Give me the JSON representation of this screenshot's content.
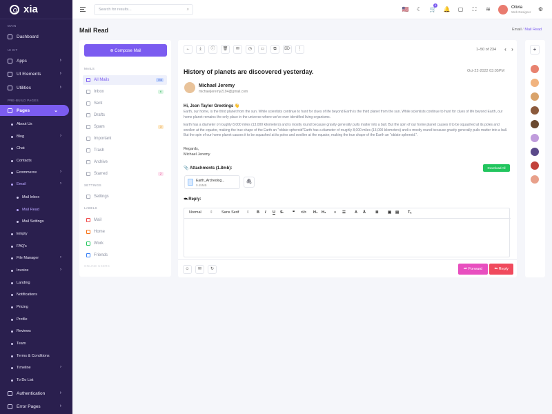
{
  "app": {
    "logo": "xia"
  },
  "sidebar": {
    "sections": {
      "main": "MAIN",
      "ui_kit": "UI KIT",
      "pre_build": "PRE-BUILD PAGES"
    },
    "items": {
      "dashboard": "Dashboard",
      "apps": "Apps",
      "ui_elements": "UI Elements",
      "utilities": "Utilities",
      "pages": "Pages",
      "authentication": "Authentication",
      "error_pages": "Error Pages"
    },
    "subitems": [
      "About Us",
      "Blog",
      "Chat",
      "Contacts",
      "Ecommerce",
      "Email",
      "Empty",
      "FAQ's",
      "File Manager",
      "Invoice",
      "Landing",
      "Notifications",
      "Pricing",
      "Profile",
      "Reviews",
      "Team",
      "Terms & Conditions",
      "Timeline",
      "To Do List"
    ],
    "email_sub": [
      "Mail Inbox",
      "Mail Read",
      "Mail Settings"
    ]
  },
  "topbar": {
    "search_placeholder": "Search for results...",
    "cart_badge": "4",
    "user_name": "Olivia",
    "user_role": "Web Designer"
  },
  "page": {
    "title": "Mail Read",
    "crumb_parent": "Email",
    "crumb_sep": "/",
    "crumb_current": "Mail Read"
  },
  "mailnav": {
    "compose": "⊕ Compose Mail",
    "mails_label": "MAILS",
    "items": [
      {
        "label": "All Mails",
        "count": "786"
      },
      {
        "label": "Inbox",
        "count": "6"
      },
      {
        "label": "Sent",
        "count": ""
      },
      {
        "label": "Drafts",
        "count": ""
      },
      {
        "label": "Spam",
        "count": "3"
      },
      {
        "label": "Important",
        "count": ""
      },
      {
        "label": "Trash",
        "count": ""
      },
      {
        "label": "Archive",
        "count": ""
      },
      {
        "label": "Starred",
        "count": "2"
      }
    ],
    "settings_label": "SETTINGS",
    "settings_item": "Settings",
    "labels_label": "LABELS",
    "labels": [
      {
        "label": "Mail",
        "color": "#ef4444"
      },
      {
        "label": "Home",
        "color": "#f97316"
      },
      {
        "label": "Work",
        "color": "#22c55e"
      },
      {
        "label": "Friends",
        "color": "#3b82f6"
      }
    ],
    "online_users_label": "ONLINE USERS"
  },
  "mail": {
    "pager": "1–50 of 234",
    "subject": "History of planets are discovered yesterday.",
    "date": "Oct-22-2022 03:05PM",
    "sender_name": "Michael Jeremy",
    "sender_email": "michaeljeremy2194@gmail.com",
    "greeting": "Hi, Json Taylor Greetings 👋",
    "para1": "Earth, our home, is the third planet from the sun. While scientists continue to hunt for clues of life beyond Earth is the third planet from the sun. While scientists continue to hunt for clues of life beyond Earth, our home planet remains the only place in the universe where we've ever identified living organisms.",
    "para2": "Earth has a diameter of roughly 8,000 miles (13,000 kilometers) and is mostly round because gravity generally pulls matter into a ball. But the spin of our home planet causes it to be squashed at its poles and swollen at the equator, making the true shape of the Earth an \"oblate spheroid\"Earth has a diameter of roughly 8,000 miles (13,000 kilometers) and is mostly round because gravity generally pulls matter into a ball. But the spin of our home planet causes it to be squashed at its poles and swollen at the equator, making the true shape of the Earth an \"oblate spheroid.\".",
    "regards": "Regards,",
    "signature": "Michael Jeremy",
    "attachments_label": "📎 Attachments (1.8mb):",
    "download_all": "Download All",
    "file_name": "Earth_Archeolog...",
    "file_size": "0.45MB",
    "reply_label": "⮪ Reply:",
    "editor": {
      "format": "Normal",
      "font": "Sans Serif"
    },
    "forward_btn": "⮫ Forward",
    "reply_btn": "⮪ Reply"
  },
  "contacts": {
    "add": "+",
    "colors": [
      "#e8826f",
      "#f1b37e",
      "#d9a36a",
      "#8b5a3c",
      "#6b4a30",
      "#c09cdc",
      "#5b4a8a",
      "#c2413a",
      "#e8a08a"
    ]
  }
}
